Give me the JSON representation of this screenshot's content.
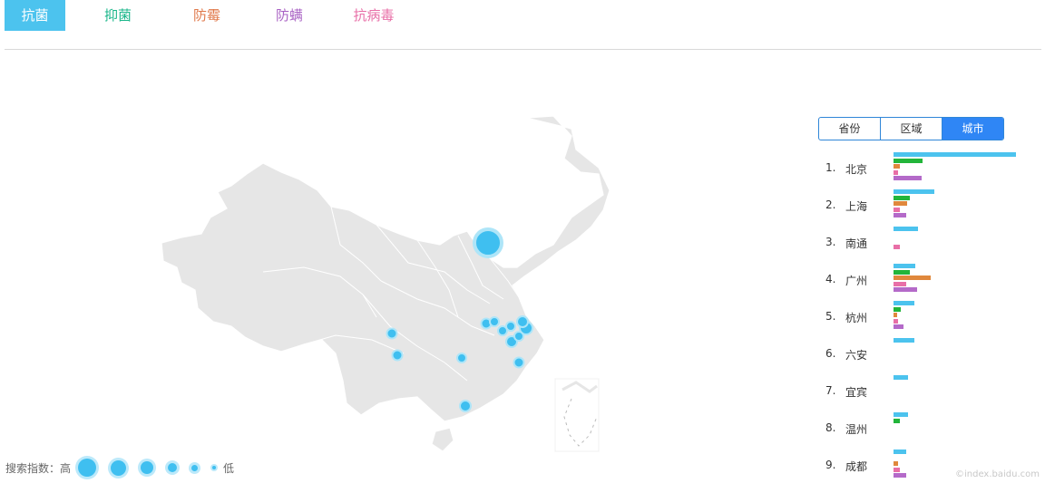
{
  "tabs": [
    {
      "label": "抗菌",
      "color": "#ffffff",
      "active": true
    },
    {
      "label": "抑菌",
      "color": "#1ab68a",
      "active": false
    },
    {
      "label": "防霉",
      "color": "#e07a4c",
      "active": false
    },
    {
      "label": "防螨",
      "color": "#a962c4",
      "active": false
    },
    {
      "label": "抗病毒",
      "color": "#e86fa7",
      "active": false
    }
  ],
  "colors": {
    "accent": "#4cc3ee",
    "series": [
      "#4cc3ee",
      "#22b53a",
      "#e0883c",
      "#e86fa7",
      "#b46ac9"
    ]
  },
  "legend": {
    "high_label": "搜索指数：高",
    "low_label": "低"
  },
  "region_tabs": [
    {
      "label": "省份",
      "active": false
    },
    {
      "label": "区域",
      "active": false
    },
    {
      "label": "城市",
      "active": true
    }
  ],
  "ranking": [
    {
      "rank": "1.",
      "city": "北京",
      "values": [
        1.0,
        0.24,
        0.05,
        0.04,
        0.23
      ]
    },
    {
      "rank": "2.",
      "city": "上海",
      "values": [
        0.33,
        0.13,
        0.11,
        0.05,
        0.1
      ]
    },
    {
      "rank": "3.",
      "city": "南通",
      "values": [
        0.2,
        0,
        0,
        0.05,
        0
      ]
    },
    {
      "rank": "4.",
      "city": "广州",
      "values": [
        0.18,
        0.13,
        0.3,
        0.1,
        0.19
      ]
    },
    {
      "rank": "5.",
      "city": "杭州",
      "values": [
        0.17,
        0.06,
        0.03,
        0.04,
        0.08
      ]
    },
    {
      "rank": "6.",
      "city": "六安",
      "values": [
        0.17,
        0,
        0,
        0,
        0
      ]
    },
    {
      "rank": "7.",
      "city": "宜宾",
      "values": [
        0.12,
        0,
        0,
        0,
        0
      ]
    },
    {
      "rank": "8.",
      "city": "温州",
      "values": [
        0.12,
        0.05,
        0,
        0,
        0
      ]
    },
    {
      "rank": "9.",
      "city": "成都",
      "values": [
        0.1,
        0,
        0.04,
        0.05,
        0.1
      ]
    }
  ],
  "map_points": [
    {
      "city": "北京",
      "level": 1.0
    },
    {
      "city": "上海",
      "level": 0.45
    },
    {
      "city": "南通",
      "level": 0.35
    },
    {
      "city": "广州",
      "level": 0.35
    },
    {
      "city": "杭州",
      "level": 0.3
    },
    {
      "city": "六安",
      "level": 0.3
    },
    {
      "city": "宜宾",
      "level": 0.3
    },
    {
      "city": "温州",
      "level": 0.3
    },
    {
      "city": "成都",
      "level": 0.3
    }
  ],
  "watermark": "©index.baidu.com"
}
